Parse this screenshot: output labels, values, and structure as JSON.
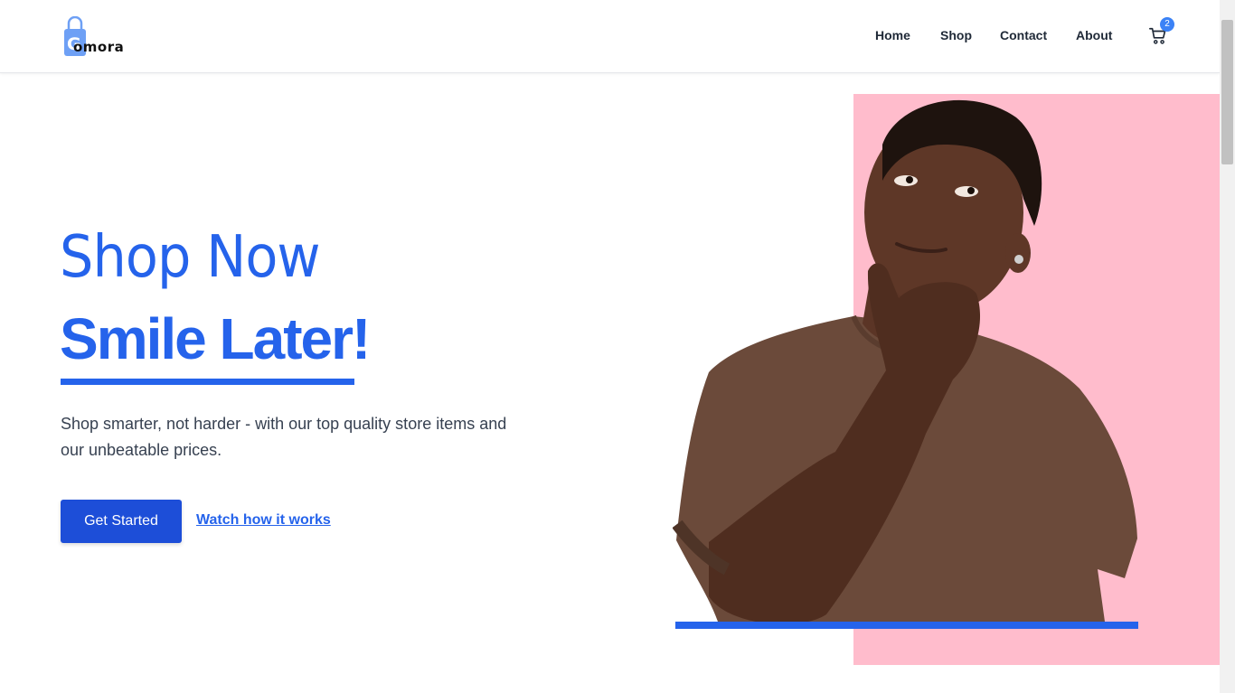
{
  "brand": {
    "name": "omora",
    "initial": "G",
    "accent": "#2563eb",
    "logo_color": "#6ea0f5"
  },
  "nav": {
    "items": [
      {
        "label": "Home"
      },
      {
        "label": "Shop"
      },
      {
        "label": "Contact"
      },
      {
        "label": "About"
      }
    ],
    "cart_count": "2",
    "cart_icon": "shopping-cart-icon"
  },
  "hero": {
    "line1": "Shop Now",
    "line2": "Smile Later!",
    "description": "Shop smarter, not harder - with our top quality store items and our unbeatable prices.",
    "cta_primary": "Get Started",
    "cta_secondary": "Watch how it works"
  },
  "image": {
    "backdrop_color": "#ffbccc",
    "shirt_color": "#6b4a3a"
  }
}
